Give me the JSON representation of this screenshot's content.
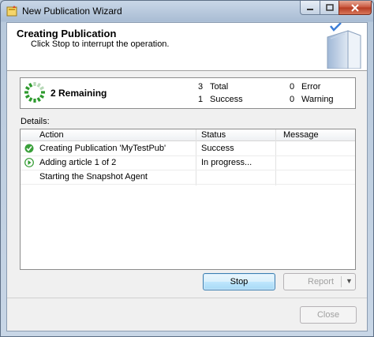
{
  "window": {
    "title": "New Publication Wizard"
  },
  "header": {
    "title": "Creating Publication",
    "subtitle": "Click Stop to interrupt the operation."
  },
  "status": {
    "remaining": "2 Remaining",
    "total_count": "3",
    "total_label": "Total",
    "success_count": "1",
    "success_label": "Success",
    "error_count": "0",
    "error_label": "Error",
    "warning_count": "0",
    "warning_label": "Warning"
  },
  "details": {
    "label": "Details:",
    "columns": [
      "Action",
      "Status",
      "Message"
    ],
    "rows": [
      {
        "icon": "success-check-icon",
        "action": "Creating Publication 'MyTestPub'",
        "status": "Success",
        "message": ""
      },
      {
        "icon": "in-progress-arrow-icon",
        "action": "Adding article 1 of 2",
        "status": "In progress...",
        "message": ""
      },
      {
        "icon": "",
        "action": "Starting the Snapshot Agent",
        "status": "",
        "message": ""
      }
    ]
  },
  "buttons": {
    "stop": "Stop",
    "report": "Report",
    "close": "Close"
  },
  "colors": {
    "success_green": "#3aa03a",
    "progress_green": "#2e9a2e",
    "title_bar": "#b6c8dc"
  }
}
